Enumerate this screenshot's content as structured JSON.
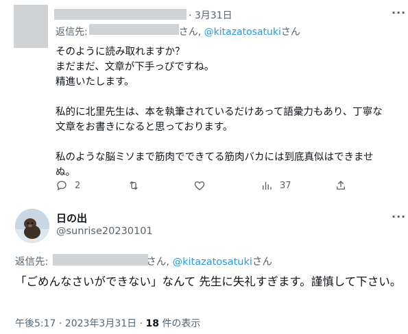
{
  "tweet1": {
    "date": "· 3月31日",
    "reply_prefix": "返信先:",
    "reply_suffix_1": "さん, ",
    "reply_handle": "@kitazatosatuki",
    "reply_suffix_2": "さん",
    "body": "そのように読み取れますか？\nまだまだ、文章が下手っぴですね。\n精進いたします。\n\n私的に北里先生は、本を執筆されているだけあって語彙力もあり、丁寧な\n文章をお書きになると思っております。\n\n私のような脳ミソまで筋肉でできてる筋肉バカには到底真似はできませ\nぬ。",
    "actions": {
      "reply_count": "2",
      "retweet_count": "",
      "like_count": "",
      "views_count": "37"
    }
  },
  "tweet2": {
    "display_name": "日の出",
    "handle": "@sunrise20230101",
    "reply_prefix": "返信先:",
    "reply_suffix_1": "さん, ",
    "reply_handle": "@kitazatosatuki",
    "reply_suffix_2": "さん",
    "body": "「ごめんなさいができない」なんて 先生に失礼すぎます。謹慎して下さい。",
    "meta_time": "午後5:17 · 2023年3月31日 · ",
    "meta_views": "18",
    "meta_views_label": " 件の表示"
  },
  "icons": {
    "more": "more-horizontal-icon",
    "reply": "reply-bubble-icon",
    "retweet": "retweet-icon",
    "like": "heart-icon",
    "views": "bar-chart-icon",
    "share": "share-upload-icon"
  },
  "colors": {
    "text": "#0f1419",
    "secondary": "#536471",
    "link": "#1d9bf0",
    "redaction": "#cfd3d6"
  }
}
